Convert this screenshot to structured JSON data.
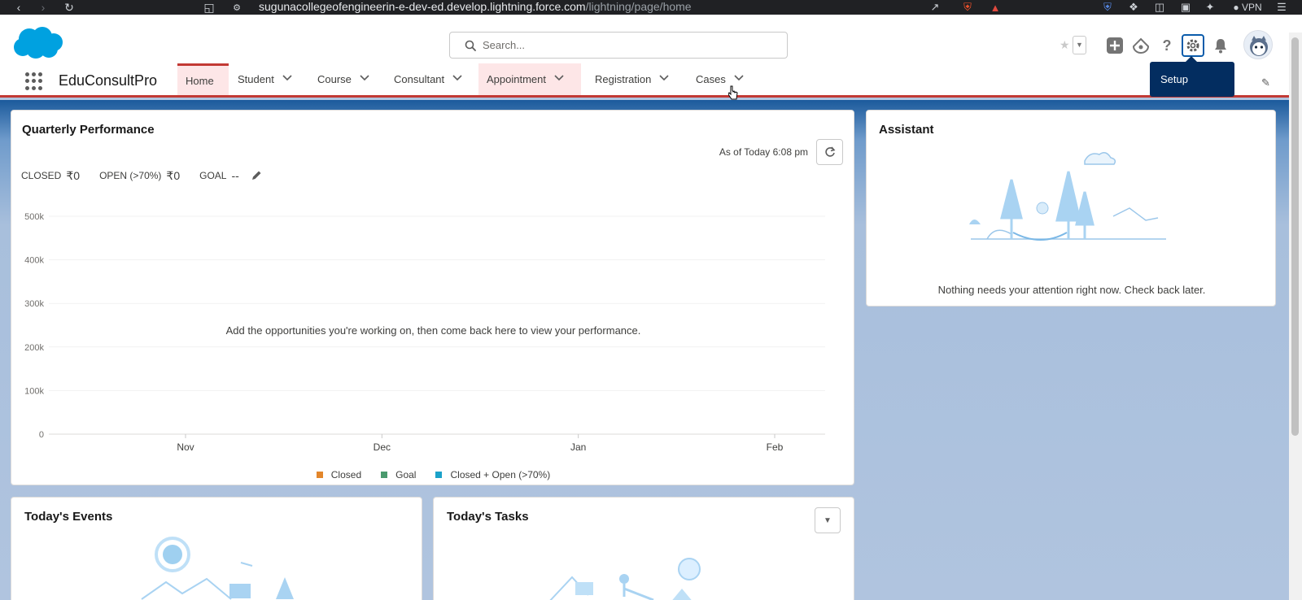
{
  "browser": {
    "url_host": "sugunacollegeofengineerin-e-dev-ed.develop.lightning.force.com",
    "url_path": "/lightning/page/home",
    "vpn_label": "VPN"
  },
  "header": {
    "search_placeholder": "Search...",
    "setup_tooltip": "Setup"
  },
  "app": {
    "name": "EduConsultPro",
    "tabs": [
      {
        "label": "Home"
      },
      {
        "label": "Student"
      },
      {
        "label": "Course"
      },
      {
        "label": "Consultant"
      },
      {
        "label": "Appointment"
      },
      {
        "label": "Registration"
      },
      {
        "label": "Cases"
      }
    ]
  },
  "quarterly": {
    "title": "Quarterly Performance",
    "as_of": "As of Today 6:08 pm",
    "closed_label": "CLOSED",
    "closed_value": "₹0",
    "open_label": "OPEN (>70%)",
    "open_value": "₹0",
    "goal_label": "GOAL",
    "goal_value": "--",
    "empty_message": "Add the opportunities you're working on, then come back here to view your performance."
  },
  "chart_data": {
    "type": "line",
    "categories": [
      "Nov",
      "Dec",
      "Jan",
      "Feb"
    ],
    "y_ticks": [
      "500k",
      "400k",
      "300k",
      "200k",
      "100k",
      "0"
    ],
    "ylim": [
      0,
      500000
    ],
    "series": [
      {
        "name": "Closed",
        "values": []
      },
      {
        "name": "Goal",
        "values": []
      },
      {
        "name": "Closed + Open (>70%)",
        "values": []
      }
    ],
    "legend_position": "bottom",
    "colors": {
      "Closed": "#e3862b",
      "Goal": "#4a9a6e",
      "Closed + Open (>70%)": "#1ba2c9"
    }
  },
  "assistant": {
    "title": "Assistant",
    "message": "Nothing needs your attention right now. Check back later."
  },
  "events": {
    "title": "Today's Events"
  },
  "tasks": {
    "title": "Today's Tasks"
  }
}
